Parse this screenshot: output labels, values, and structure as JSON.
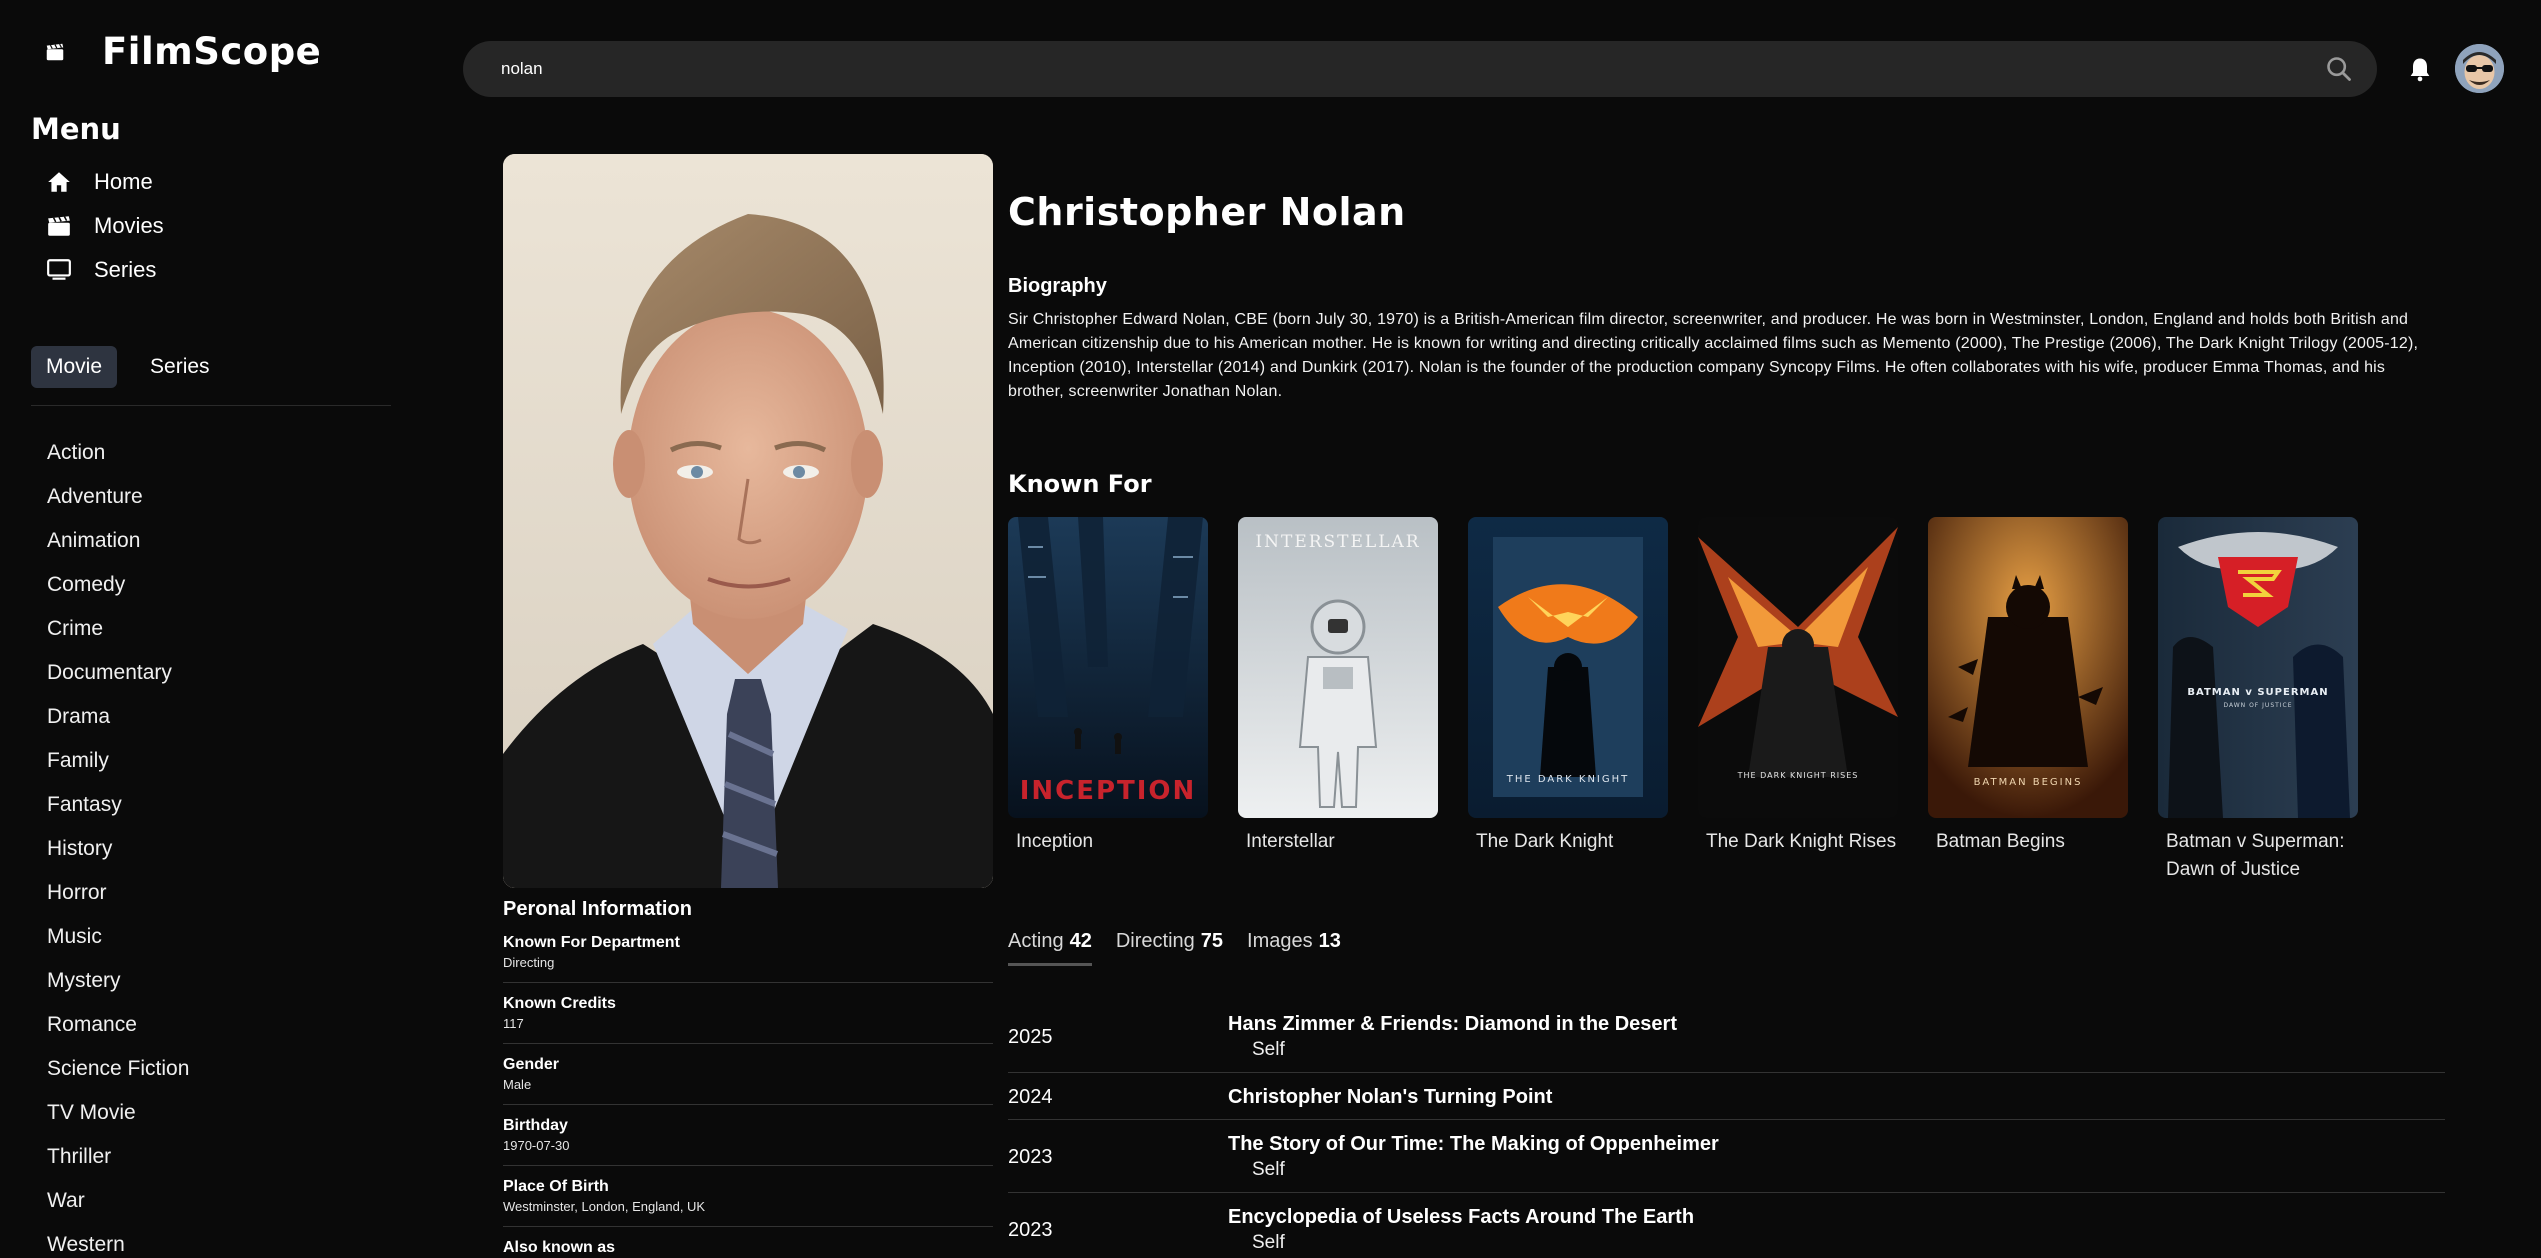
{
  "brand": {
    "title": "FilmScope",
    "icon": "clapperboard-icon"
  },
  "menu": {
    "heading": "Menu",
    "items": [
      {
        "label": "Home",
        "icon": "home-icon"
      },
      {
        "label": "Movies",
        "icon": "clapperboard-icon"
      },
      {
        "label": "Series",
        "icon": "monitor-icon"
      }
    ]
  },
  "type_toggle": {
    "active": "Movie",
    "options": [
      "Movie",
      "Series"
    ]
  },
  "genres": [
    "Action",
    "Adventure",
    "Animation",
    "Comedy",
    "Crime",
    "Documentary",
    "Drama",
    "Family",
    "Fantasy",
    "History",
    "Horror",
    "Music",
    "Mystery",
    "Romance",
    "Science Fiction",
    "TV Movie",
    "Thriller",
    "War",
    "Western"
  ],
  "search": {
    "value": "nolan",
    "icon": "search-icon"
  },
  "header": {
    "bell_icon": "bell-icon",
    "avatar": "user-avatar"
  },
  "person": {
    "name": "Christopher Nolan",
    "biography_heading": "Biography",
    "biography": "Sir Christopher Edward Nolan, CBE (born July 30, 1970) is a British-American film director, screenwriter, and producer. He was born in Westminster, London, England and holds both British and American citizenship due to his American mother. He is known for writing and directing critically acclaimed films such as Memento (2000), The Prestige (2006), The Dark Knight Trilogy (2005-12), Inception (2010), Interstellar (2014) and Dunkirk (2017). Nolan is the founder of the production company Syncopy Films. He often collaborates with his wife, producer Emma Thomas, and his brother, screenwriter Jonathan Nolan."
  },
  "personal_info": {
    "heading": "Peronal Information",
    "items": [
      {
        "label": "Known For Department",
        "value": "Directing"
      },
      {
        "label": "Known Credits",
        "value": "117"
      },
      {
        "label": "Gender",
        "value": "Male"
      },
      {
        "label": "Birthday",
        "value": "1970-07-30"
      },
      {
        "label": "Place Of Birth",
        "value": "Westminster, London, England, UK"
      },
      {
        "label": "Also known as",
        "value": ""
      }
    ]
  },
  "known_for": {
    "heading": "Known For",
    "items": [
      {
        "title": "Inception",
        "poster_text": "INCEPTION",
        "color": "#c8232c"
      },
      {
        "title": "Interstellar",
        "poster_text": "INTERSTELLAR",
        "color": "#d9dde0"
      },
      {
        "title": "The Dark Knight",
        "poster_text": "THE DARK KNIGHT",
        "color": "#f07a1a"
      },
      {
        "title": "The Dark Knight Rises",
        "poster_text": "THE DARK KNIGHT RISES",
        "color": "#e8552a"
      },
      {
        "title": "Batman Begins",
        "poster_text": "BATMAN BEGINS",
        "color": "#e07b28"
      },
      {
        "title": "Batman v Superman: Dawn of Justice",
        "poster_text": "BATMAN v SUPERMAN",
        "poster_subtext": "DAWN OF JUSTICE",
        "color": "#d61f26"
      }
    ]
  },
  "credit_tabs": [
    {
      "label": "Acting",
      "count": "42",
      "active": true
    },
    {
      "label": "Directing",
      "count": "75",
      "active": false
    },
    {
      "label": "Images",
      "count": "13",
      "active": false
    }
  ],
  "credits": [
    {
      "year": "2025",
      "title": "Hans Zimmer & Friends: Diamond in the Desert",
      "role": "Self"
    },
    {
      "year": "2024",
      "title": "Christopher Nolan's Turning Point",
      "role": ""
    },
    {
      "year": "2023",
      "title": "The Story of Our Time: The Making of Oppenheimer",
      "role": "Self"
    },
    {
      "year": "2023",
      "title": "Encyclopedia of Useless Facts Around The Earth",
      "role": "Self"
    }
  ]
}
